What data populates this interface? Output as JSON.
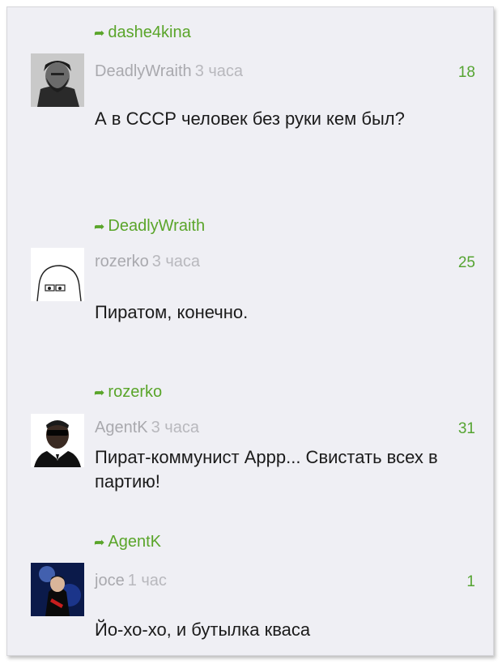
{
  "comments": [
    {
      "reply_to": "dashe4kina",
      "author": "DeadlyWraith",
      "time": "3 часа",
      "score": "18",
      "text": "А в СССР человек без руки кем был?"
    },
    {
      "reply_to": "DeadlyWraith",
      "author": "rozerko",
      "time": "3 часа",
      "score": "25",
      "text": "Пиратом, конечно."
    },
    {
      "reply_to": "rozerko",
      "author": "AgentK",
      "time": "3 часа",
      "score": "31",
      "text": "Пират-коммунист Аррр... Свистать всех в партию!"
    },
    {
      "reply_to": "AgentK",
      "author": "joce",
      "time": "1 час",
      "score": "1",
      "text": "Йо-хо-хо, и бутылка кваса"
    }
  ],
  "colors": {
    "accent_green": "#5aa52a",
    "background": "#efeff4",
    "meta_gray": "#a9a9ae",
    "text": "#1b1b1b"
  },
  "icons": {
    "reply": "reply-arrow-icon"
  }
}
